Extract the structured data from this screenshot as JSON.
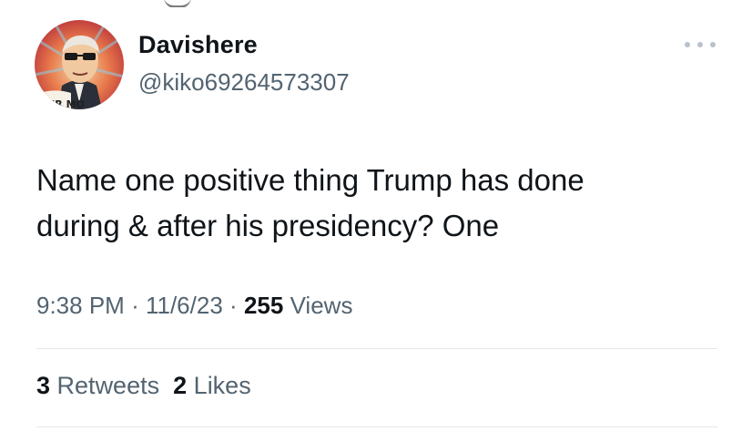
{
  "author": {
    "display_name": "Davishere",
    "handle": "@kiko69264573307",
    "avatar_text": "OUR MO"
  },
  "tweet": {
    "text_line_1": "Name one positive thing Trump has done",
    "text_line_2": "during & after his presidency? One"
  },
  "meta": {
    "time": "9:38 PM",
    "separator": "·",
    "date": "11/6/23",
    "views_count": "255",
    "views_label": "Views"
  },
  "stats": {
    "retweets_count": "3",
    "retweets_label": "Retweets",
    "likes_count": "2",
    "likes_label": "Likes"
  },
  "icons": {
    "more": "more-horizontal-icon"
  },
  "colors": {
    "text_primary": "#0f1419",
    "text_secondary": "#536471",
    "divider": "#e3e8ec"
  }
}
